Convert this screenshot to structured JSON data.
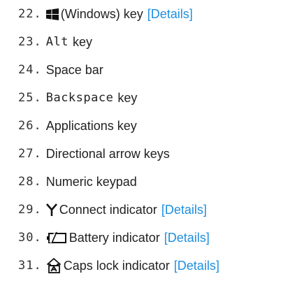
{
  "items": [
    {
      "number": "22.",
      "text": "(Windows) key",
      "link": "[Details]",
      "icon": "windows-logo-icon"
    },
    {
      "number": "23.",
      "key": "Alt",
      "text": "key"
    },
    {
      "number": "24.",
      "text": "Space bar"
    },
    {
      "number": "25.",
      "key": "Backspace",
      "text": "key"
    },
    {
      "number": "26.",
      "text": "Applications key"
    },
    {
      "number": "27.",
      "text": "Directional arrow keys"
    },
    {
      "number": "28.",
      "text": "Numeric keypad"
    },
    {
      "number": "29.",
      "text": "Connect indicator",
      "link": "[Details]",
      "icon": "antenna-icon"
    },
    {
      "number": "30.",
      "text": "Battery indicator",
      "link": "[Details]",
      "icon": "battery-icon"
    },
    {
      "number": "31.",
      "text": "Caps lock indicator",
      "link": "[Details]",
      "icon": "caps-lock-icon"
    }
  ],
  "colors": {
    "text": "#222222",
    "link": "#1e8fe0"
  }
}
